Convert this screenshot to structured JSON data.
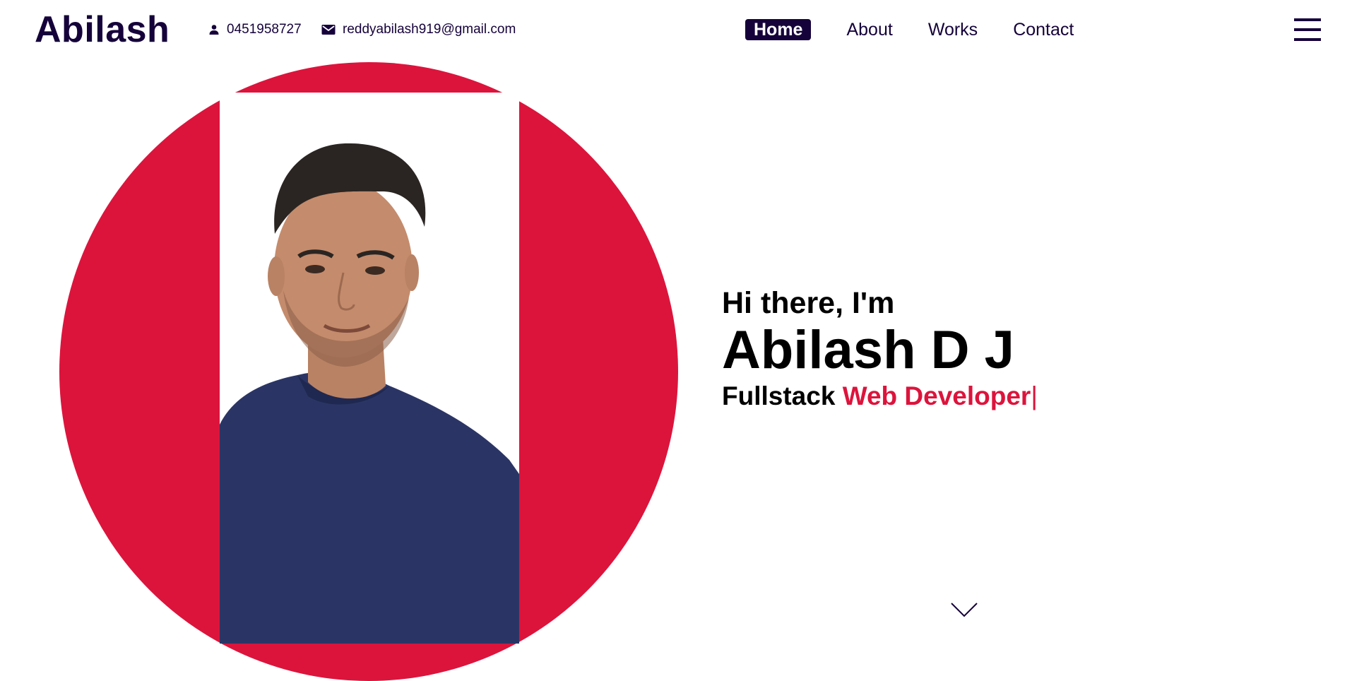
{
  "header": {
    "logo": "Abilash",
    "phone": "0451958727",
    "email": "reddyabilash919@gmail.com"
  },
  "nav": {
    "items": [
      {
        "label": "Home",
        "active": true
      },
      {
        "label": "About",
        "active": false
      },
      {
        "label": "Works",
        "active": false
      },
      {
        "label": "Contact",
        "active": false
      }
    ]
  },
  "hero": {
    "greeting": "Hi there, I'm",
    "name": "Abilash D J",
    "role_prefix": "Fullstack",
    "role_accent": "Web Developer",
    "cursor": "|"
  },
  "icons": {
    "phone": "person-icon",
    "email": "mail-icon",
    "menu": "hamburger-menu-icon",
    "scroll": "chevron-down-icon"
  },
  "colors": {
    "primary": "#15023a",
    "accent": "#dc143c",
    "background": "#ffffff"
  }
}
